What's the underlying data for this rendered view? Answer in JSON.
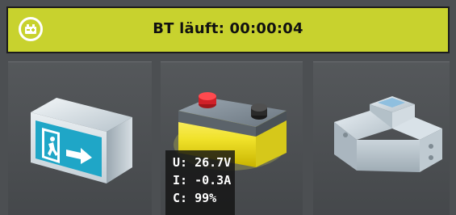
{
  "status_bar": {
    "text": "BT läuft: 00:00:04",
    "background_color": "#c8d22e",
    "icon": "battery-operation-icon"
  },
  "tiles": [
    {
      "icon": "emergency-exit-sign-icon"
    },
    {
      "icon": "battery-icon"
    },
    {
      "icon": "din-rail-module-icon"
    }
  ],
  "battery": {
    "voltage": "U: 26.7V",
    "current": "I: -0.3A",
    "capacity": "C: 99%"
  }
}
